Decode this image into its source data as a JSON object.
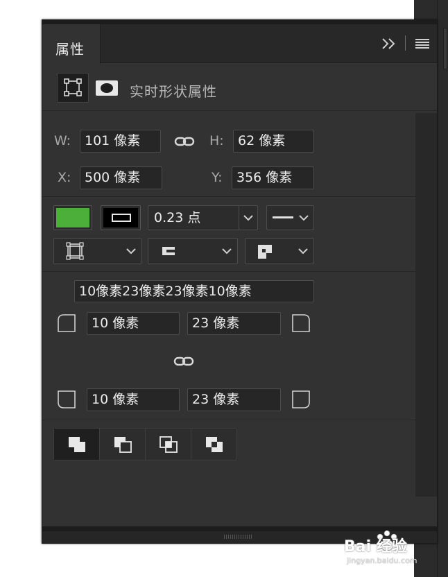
{
  "panel": {
    "tab_label": "属性",
    "section_title": "实时形状属性",
    "icons": [
      "panel-collapse-icon",
      "panel-menu-icon",
      "shape-transform-icon",
      "mask-icon"
    ]
  },
  "transform": {
    "w_label": "W:",
    "w_value": "101 像素",
    "h_label": "H:",
    "h_value": "62 像素",
    "x_label": "X:",
    "x_value": "500 像素",
    "y_label": "Y:",
    "y_value": "356 像素"
  },
  "appearance": {
    "fill_color": "#4caf3a",
    "stroke_color": "#000000",
    "stroke_width": "0.23 点"
  },
  "corners": {
    "summary": "10像素23像素23像素10像素",
    "top_left": "10 像素",
    "top_right": "23 像素",
    "bottom_left": "10 像素",
    "bottom_right": "23 像素"
  },
  "path_operations": [
    "combine-shapes",
    "subtract-front-shape",
    "intersect-shape-areas",
    "exclude-overlapping-shapes"
  ],
  "watermark": {
    "brand": "Bai 经验",
    "url": "jingyan.baidu.com"
  }
}
